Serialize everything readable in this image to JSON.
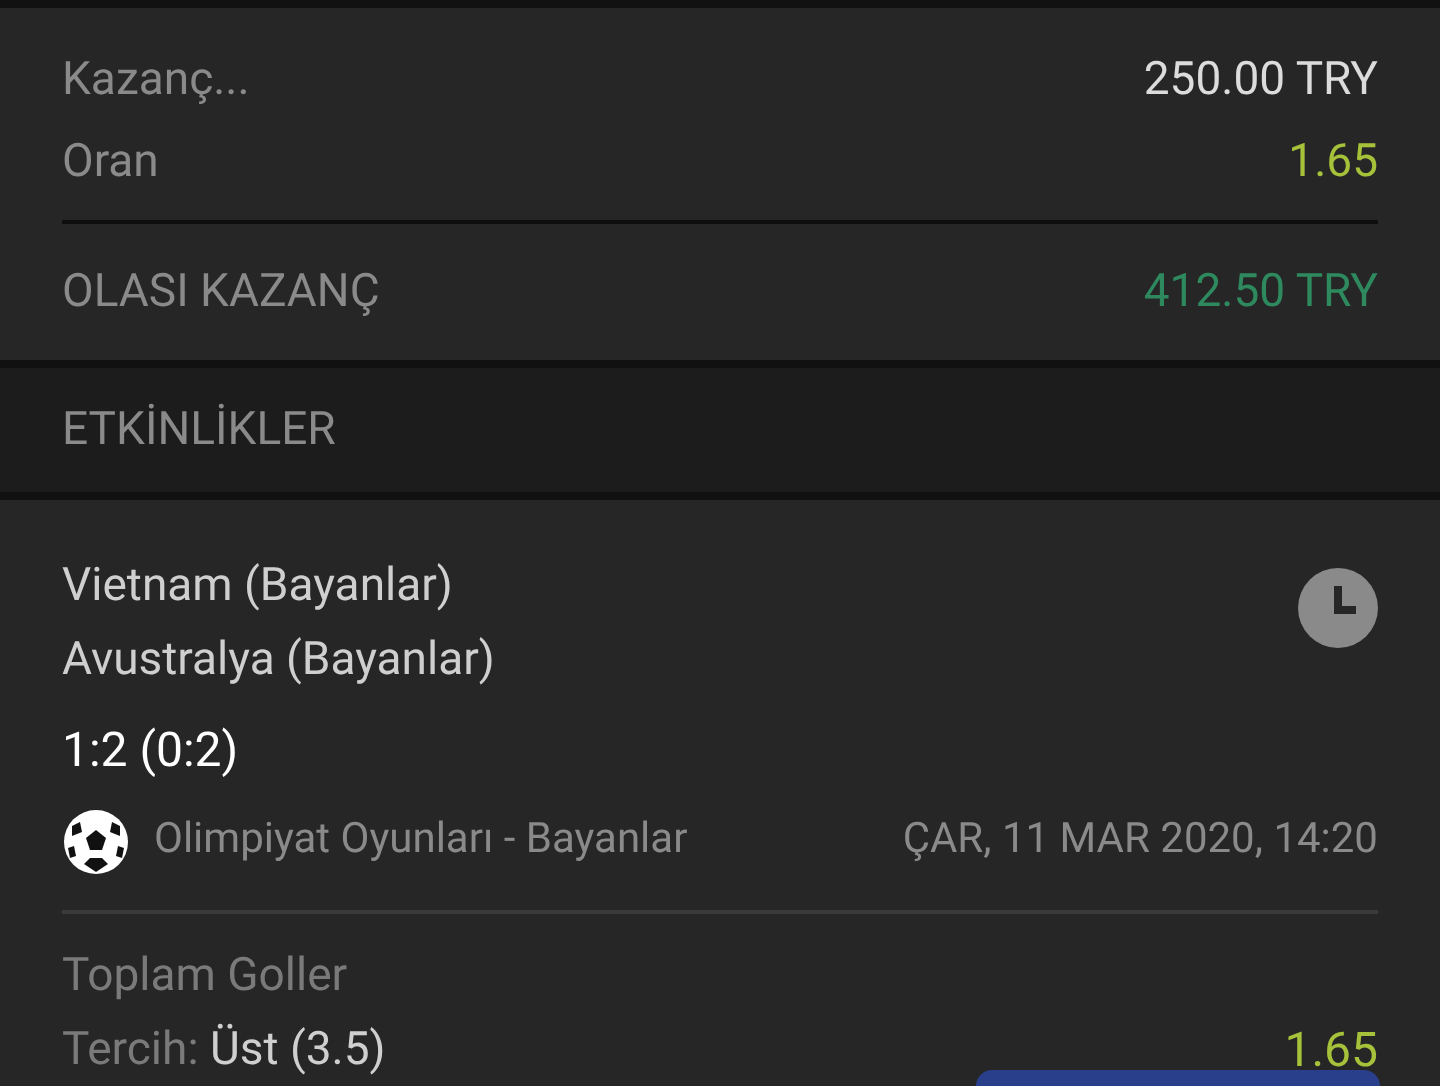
{
  "summary": {
    "rows": [
      {
        "label": "Kazanç...",
        "value": "250.00 TRY",
        "kind": "amount"
      },
      {
        "label": "Oran",
        "value": "1.65",
        "kind": "odds"
      }
    ],
    "total": {
      "label": "OLASI KAZANÇ",
      "value": "412.50 TRY"
    }
  },
  "events_header": "ETKİNLİKLER",
  "event": {
    "home": "Vietnam (Bayanlar)",
    "away": "Avustralya (Bayanlar)",
    "score": "1:2 (0:2)",
    "league": "Olimpiyat Oyunları - Bayanlar",
    "date": "ÇAR, 11 MAR 2020, 14:20",
    "market": "Toplam Goller",
    "choice_label": "Tercih:",
    "choice": "Üst (3.5)",
    "odds": "1.65"
  }
}
